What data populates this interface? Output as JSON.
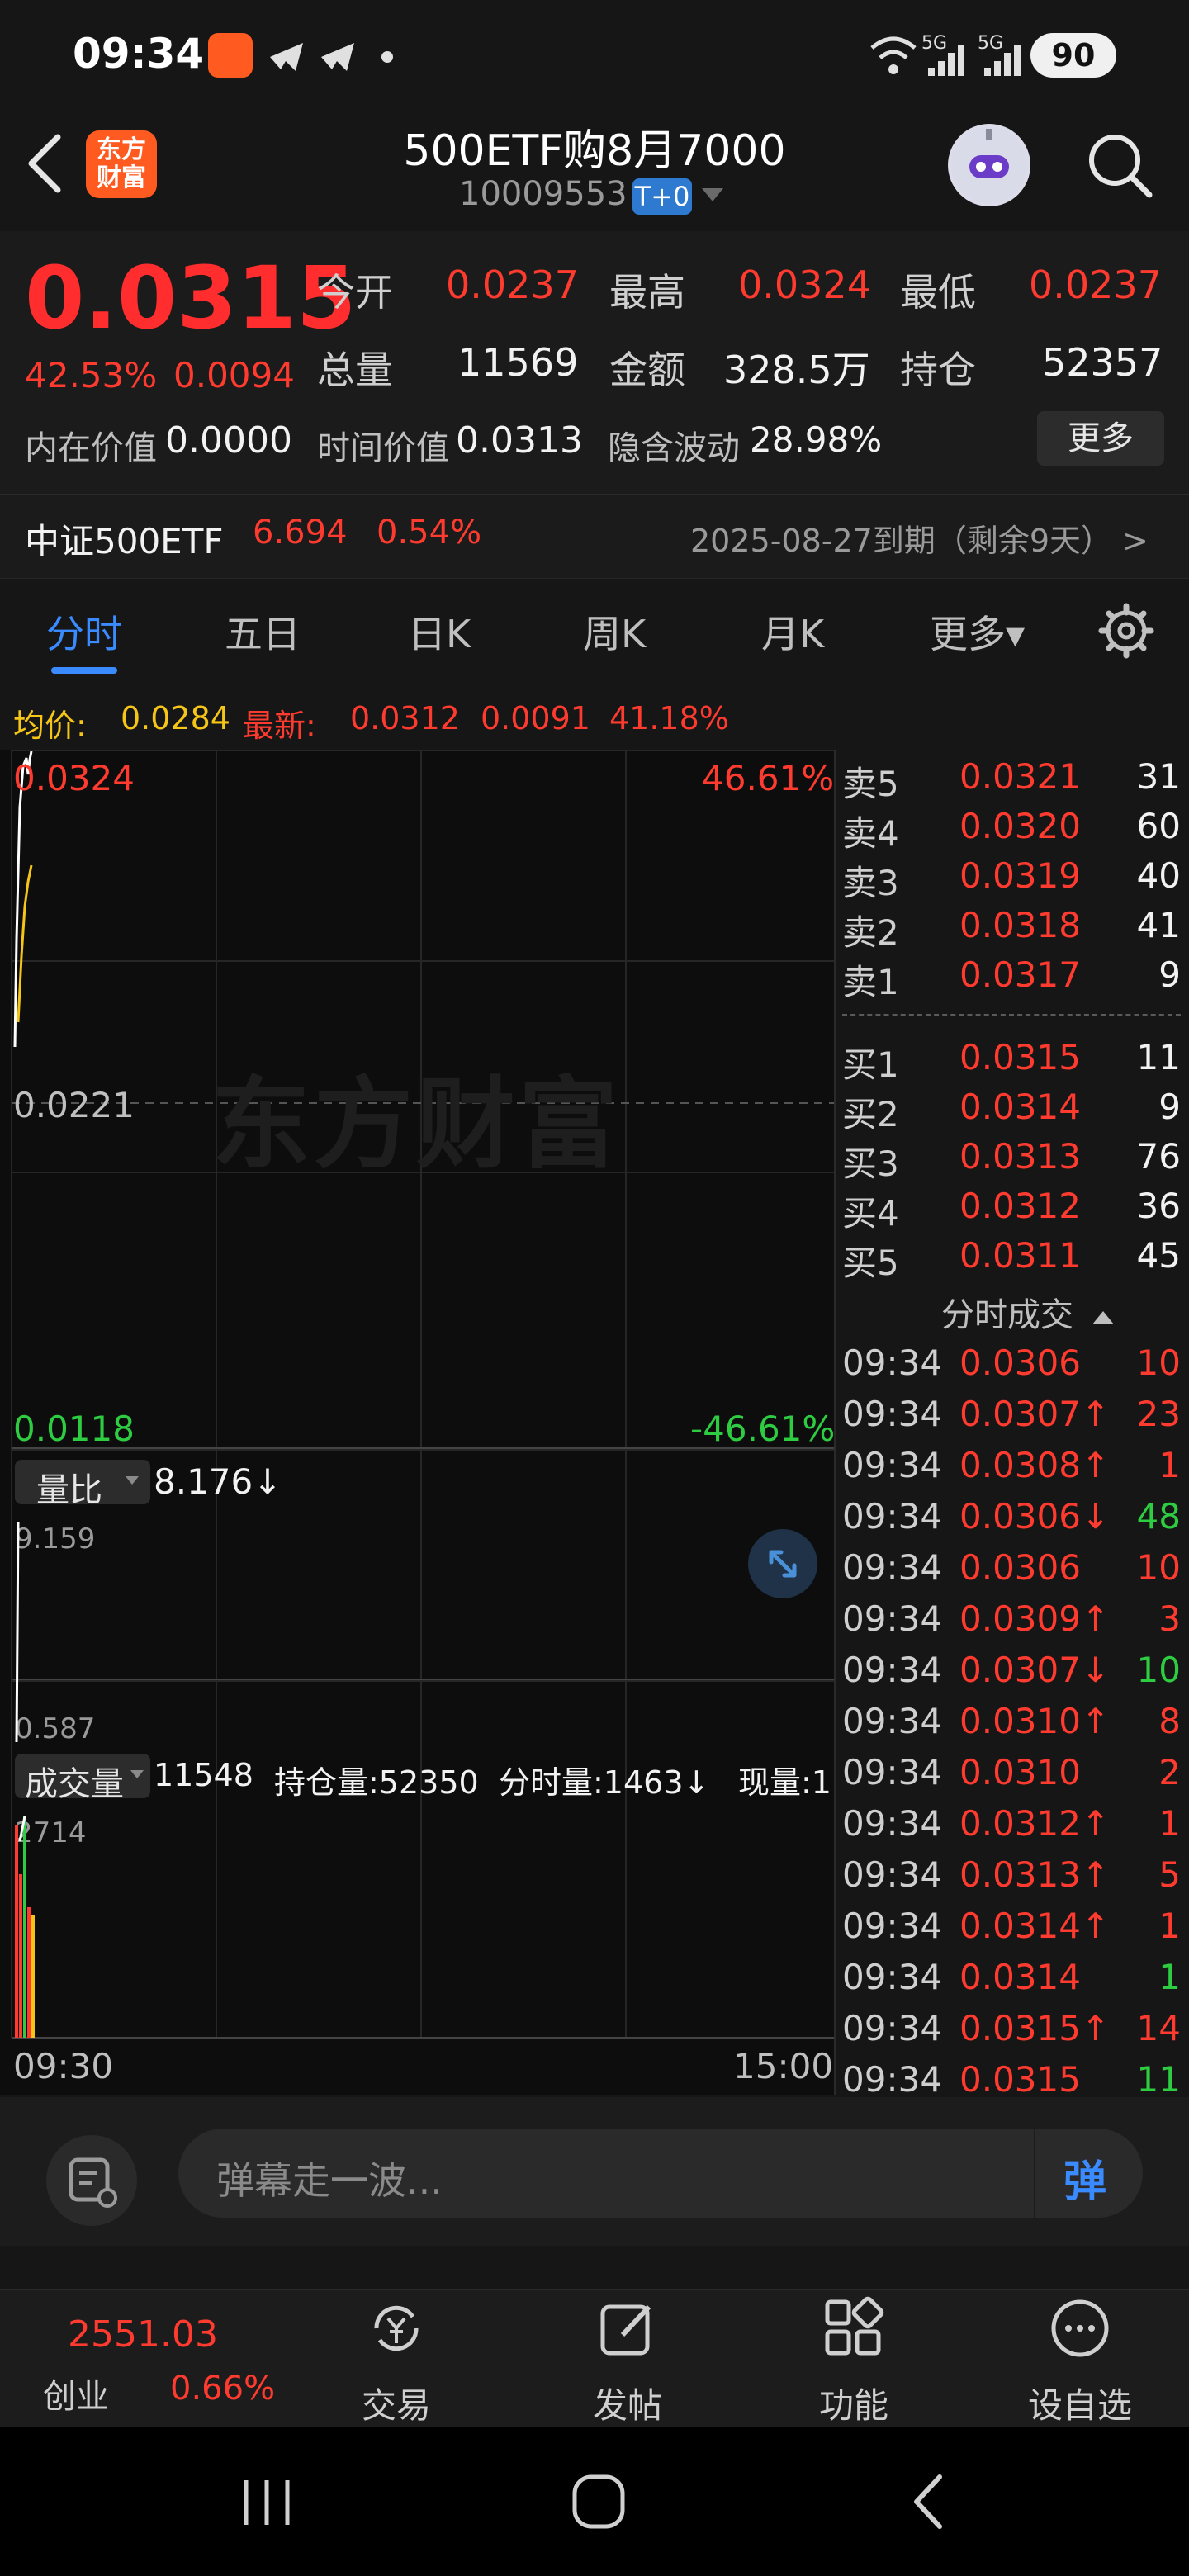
{
  "status_bar": {
    "time": "09:34",
    "battery": "90",
    "network_1": "5G",
    "network_2": "5G"
  },
  "header": {
    "logo_text_1": "东方",
    "logo_text_2": "财富",
    "title": "500ETF购8月7000",
    "code": "10009553",
    "tag": "T+0"
  },
  "quote": {
    "last_price": "0.0315",
    "change_pct": "42.53%",
    "change_abs": "0.0094",
    "open_label": "今开",
    "open": "0.0237",
    "high_label": "最高",
    "high": "0.0324",
    "low_label": "最低",
    "low": "0.0237",
    "vol_label": "总量",
    "vol": "11569",
    "amount_label": "金额",
    "amount": "328.5万",
    "oi_label": "持仓",
    "oi": "52357",
    "intrinsic_label": "内在价值",
    "intrinsic": "0.0000",
    "time_value_label": "时间价值",
    "time_value": "0.0313",
    "iv_label": "隐含波动",
    "iv": "28.98%",
    "more_label": "更多"
  },
  "underlying": {
    "name": "中证500ETF",
    "price": "6.694",
    "pct": "0.54%",
    "expiry": "2025-08-27到期（剩余9天） >"
  },
  "tabs": [
    "分时",
    "五日",
    "日K",
    "周K",
    "月K",
    "更多▾"
  ],
  "info_line": {
    "avg_label": "均价:",
    "avg": "0.0284",
    "latest_label": "最新:",
    "latest": "0.0312",
    "change": "0.0091",
    "pct": "41.18%"
  },
  "chart": {
    "top_price": "0.0324",
    "top_pct": "46.61%",
    "mid_price": "0.0221",
    "bottom_price": "0.0118",
    "bottom_pct": "-46.61%",
    "watermark": "东方财富",
    "volume_ratio_label": "量比",
    "volume_ratio": "8.176↓",
    "vr_top": "9.159",
    "vr_bottom": "0.587",
    "vol_label": "成交量",
    "vol_value": "11548",
    "oi_info": "持仓量:52350",
    "tick_vol_info": "分时量:1463↓",
    "now_vol_info": "现量:1",
    "vol_top": "2714",
    "time_start": "09:30",
    "time_end": "15:00",
    "colors": {
      "price": "#ffffff",
      "avg": "#f5c518",
      "red": "#ff3b30",
      "green": "#2ecc40"
    }
  },
  "order_book": {
    "asks": [
      {
        "label": "卖5",
        "price": "0.0321",
        "vol": "31"
      },
      {
        "label": "卖4",
        "price": "0.0320",
        "vol": "60"
      },
      {
        "label": "卖3",
        "price": "0.0319",
        "vol": "40"
      },
      {
        "label": "卖2",
        "price": "0.0318",
        "vol": "41"
      },
      {
        "label": "卖1",
        "price": "0.0317",
        "vol": "9"
      }
    ],
    "bids": [
      {
        "label": "买1",
        "price": "0.0315",
        "vol": "11"
      },
      {
        "label": "买2",
        "price": "0.0314",
        "vol": "9"
      },
      {
        "label": "买3",
        "price": "0.0313",
        "vol": "76"
      },
      {
        "label": "买4",
        "price": "0.0312",
        "vol": "36"
      },
      {
        "label": "买5",
        "price": "0.0311",
        "vol": "45"
      }
    ],
    "ticks_header": "分时成交",
    "ticks": [
      {
        "time": "09:34",
        "price": "0.0306",
        "vol": "10",
        "dir": "red"
      },
      {
        "time": "09:34",
        "price": "0.0307↑",
        "vol": "23",
        "dir": "red"
      },
      {
        "time": "09:34",
        "price": "0.0308↑",
        "vol": "1",
        "dir": "red"
      },
      {
        "time": "09:34",
        "price": "0.0306↓",
        "vol": "48",
        "dir": "green"
      },
      {
        "time": "09:34",
        "price": "0.0306",
        "vol": "10",
        "dir": "red"
      },
      {
        "time": "09:34",
        "price": "0.0309↑",
        "vol": "3",
        "dir": "red"
      },
      {
        "time": "09:34",
        "price": "0.0307↓",
        "vol": "10",
        "dir": "green"
      },
      {
        "time": "09:34",
        "price": "0.0310↑",
        "vol": "8",
        "dir": "red"
      },
      {
        "time": "09:34",
        "price": "0.0310",
        "vol": "2",
        "dir": "red"
      },
      {
        "time": "09:34",
        "price": "0.0312↑",
        "vol": "1",
        "dir": "red"
      },
      {
        "time": "09:34",
        "price": "0.0313↑",
        "vol": "5",
        "dir": "red"
      },
      {
        "time": "09:34",
        "price": "0.0314↑",
        "vol": "1",
        "dir": "red"
      },
      {
        "time": "09:34",
        "price": "0.0314",
        "vol": "1",
        "dir": "green"
      },
      {
        "time": "09:34",
        "price": "0.0315↑",
        "vol": "14",
        "dir": "red"
      },
      {
        "time": "09:34",
        "price": "0.0315",
        "vol": "11",
        "dir": "green"
      }
    ]
  },
  "danmaku": {
    "placeholder": "弹幕走一波...",
    "send_label": "弹"
  },
  "bottom_nav": {
    "index_value": "2551.03",
    "index_name": "创业",
    "index_pct": "0.66%",
    "items": [
      "交易",
      "发帖",
      "功能",
      "设自选"
    ]
  }
}
